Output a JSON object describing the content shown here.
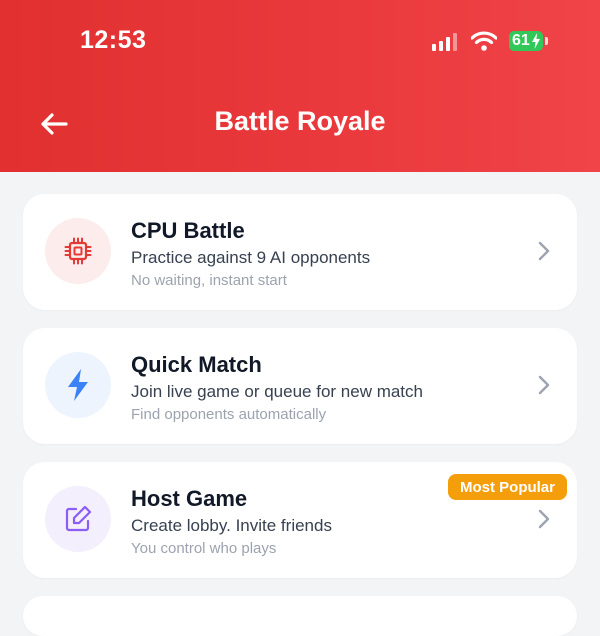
{
  "status_bar": {
    "time": "12:53",
    "battery_level": "61",
    "icons": [
      "cellular-signal-icon",
      "wifi-icon",
      "battery-charging-icon"
    ]
  },
  "header": {
    "title": "Battle Royale",
    "back_icon": "arrow-left-icon",
    "background_color": "#e63434"
  },
  "modes": [
    {
      "title": "CPU Battle",
      "subtitle": "Practice against 9 AI opponents",
      "hint": "No waiting, instant start",
      "icon": "cpu-chip-icon",
      "icon_color": "#e53935",
      "icon_bg": "#fdecec"
    },
    {
      "title": "Quick Match",
      "subtitle": "Join live game or queue for new match",
      "hint": "Find opponents automatically",
      "icon": "lightning-bolt-icon",
      "icon_color": "#3b82f6",
      "icon_bg": "#eef4fe"
    },
    {
      "title": "Host Game",
      "subtitle": "Create lobby. Invite friends",
      "hint": "You control who plays",
      "icon": "edit-square-icon",
      "icon_color": "#8b5cf6",
      "icon_bg": "#f3effd",
      "badge": "Most Popular",
      "badge_color": "#f59e0b"
    }
  ]
}
